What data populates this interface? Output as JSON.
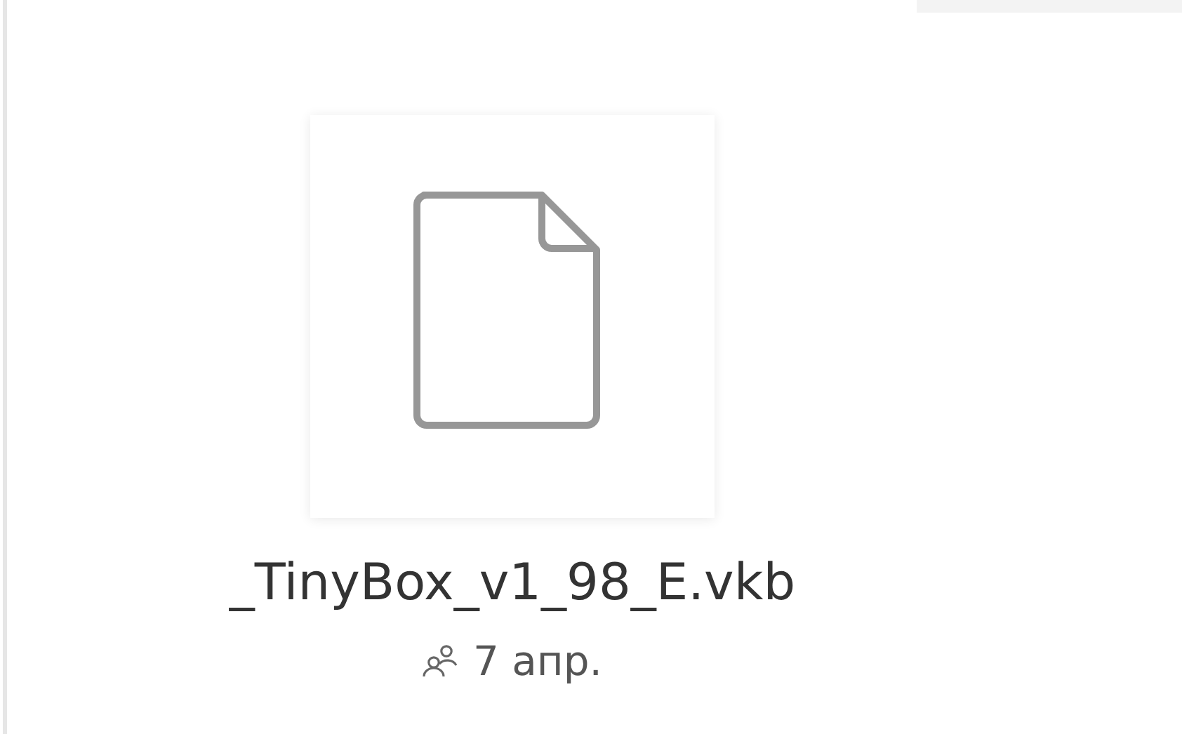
{
  "file": {
    "kind": "file",
    "name": "_TinyBox_v1_98_E.vkb",
    "shared": true,
    "date": "7 апр."
  }
}
